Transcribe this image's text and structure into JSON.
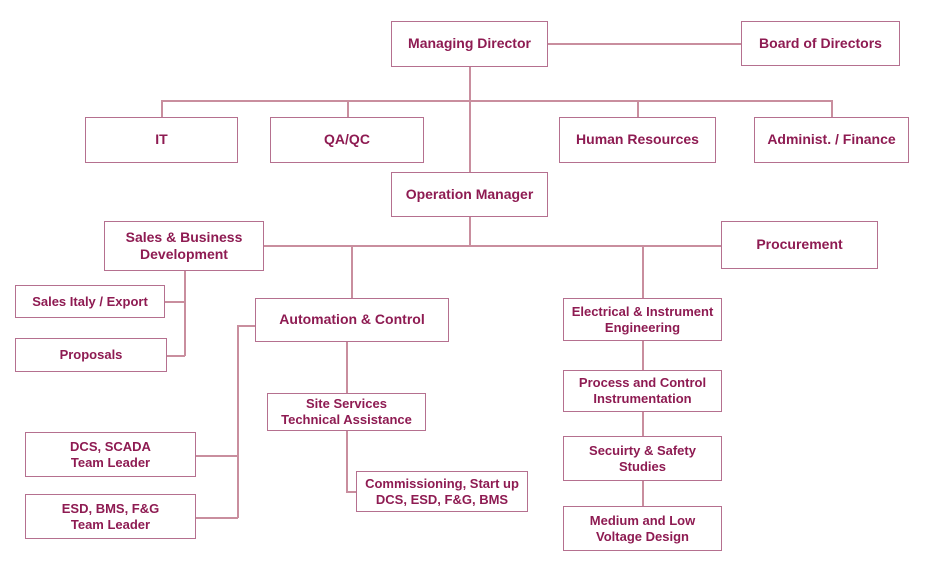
{
  "chart_data": {
    "type": "diagram",
    "title": "Company Organization Chart",
    "diagram_kind": "organizational-chart",
    "colors": {
      "box_border": "#b5708f",
      "text": "#8e1b52",
      "connector": "#c98e9e",
      "background": "#ffffff"
    },
    "nodes": [
      {
        "id": "managing_director",
        "label": "Managing Director",
        "level": 1
      },
      {
        "id": "board_of_directors",
        "label": "Board of Directors",
        "level": 1
      },
      {
        "id": "it",
        "label": "IT",
        "level": 2
      },
      {
        "id": "qa_qc",
        "label": "QA/QC",
        "level": 2
      },
      {
        "id": "human_resources",
        "label": "Human Resources",
        "level": 2
      },
      {
        "id": "admin_finance",
        "label": "Administ. / Finance",
        "level": 2
      },
      {
        "id": "operation_manager",
        "label": "Operation Manager",
        "level": 3
      },
      {
        "id": "sales_business_development",
        "label": "Sales & Business\nDevelopment",
        "level": 4
      },
      {
        "id": "procurement",
        "label": "Procurement",
        "level": 4
      },
      {
        "id": "sales_italy_export",
        "label": "Sales Italy / Export",
        "level": 5
      },
      {
        "id": "proposals",
        "label": "Proposals",
        "level": 5
      },
      {
        "id": "automation_control",
        "label": "Automation & Control",
        "level": 5
      },
      {
        "id": "electrical_instrument_engineering",
        "label": "Electrical & Instrument\nEngineering",
        "level": 5
      },
      {
        "id": "process_control_instrumentation",
        "label": "Process and Control\nInstrumentation",
        "level": 6
      },
      {
        "id": "site_services_technical_assistance",
        "label": "Site Services\nTechnical Assistance",
        "level": 6
      },
      {
        "id": "security_safety_studies",
        "label": "Secuirty & Safety\nStudies",
        "level": 7
      },
      {
        "id": "dcs_scada_team_leader",
        "label": "DCS, SCADA\nTeam Leader",
        "level": 7
      },
      {
        "id": "commissioning_startup",
        "label": "Commissioning, Start up\nDCS, ESD, F&G, BMS",
        "level": 7
      },
      {
        "id": "esd_bms_fg_team_leader",
        "label": "ESD, BMS, F&G\nTeam Leader",
        "level": 8
      },
      {
        "id": "medium_low_voltage_design",
        "label": "Medium and Low\nVoltage Design",
        "level": 8
      }
    ],
    "edges": [
      {
        "from": "managing_director",
        "to": "board_of_directors"
      },
      {
        "from": "managing_director",
        "to": "it"
      },
      {
        "from": "managing_director",
        "to": "qa_qc"
      },
      {
        "from": "managing_director",
        "to": "human_resources"
      },
      {
        "from": "managing_director",
        "to": "admin_finance"
      },
      {
        "from": "managing_director",
        "to": "operation_manager"
      },
      {
        "from": "operation_manager",
        "to": "sales_business_development"
      },
      {
        "from": "operation_manager",
        "to": "procurement"
      },
      {
        "from": "operation_manager",
        "to": "automation_control"
      },
      {
        "from": "operation_manager",
        "to": "electrical_instrument_engineering"
      },
      {
        "from": "sales_business_development",
        "to": "sales_italy_export"
      },
      {
        "from": "sales_business_development",
        "to": "proposals"
      },
      {
        "from": "automation_control",
        "to": "site_services_technical_assistance"
      },
      {
        "from": "automation_control",
        "to": "dcs_scada_team_leader"
      },
      {
        "from": "automation_control",
        "to": "esd_bms_fg_team_leader"
      },
      {
        "from": "site_services_technical_assistance",
        "to": "commissioning_startup"
      },
      {
        "from": "electrical_instrument_engineering",
        "to": "process_control_instrumentation"
      },
      {
        "from": "process_control_instrumentation",
        "to": "security_safety_studies"
      },
      {
        "from": "security_safety_studies",
        "to": "medium_low_voltage_design"
      }
    ]
  },
  "boxes": {
    "managing_director": {
      "line1": "Managing Director"
    },
    "board_of_directors": {
      "line1": "Board of Directors"
    },
    "it": {
      "line1": "IT"
    },
    "qa_qc": {
      "line1": "QA/QC"
    },
    "human_resources": {
      "line1": "Human Resources"
    },
    "admin_finance": {
      "line1": "Administ. / Finance"
    },
    "operation_manager": {
      "line1": "Operation Manager"
    },
    "sales_business_development": {
      "line1": "Sales & Business",
      "line2": "Development"
    },
    "procurement": {
      "line1": "Procurement"
    },
    "sales_italy_export": {
      "line1": "Sales Italy / Export"
    },
    "proposals": {
      "line1": "Proposals"
    },
    "automation_control": {
      "line1": "Automation & Control"
    },
    "electrical_instrument_engineering": {
      "line1": "Electrical & Instrument",
      "line2": "Engineering"
    },
    "process_control_instrumentation": {
      "line1": "Process and Control",
      "line2": "Instrumentation"
    },
    "site_services_technical_assistance": {
      "line1": "Site Services",
      "line2": "Technical Assistance"
    },
    "security_safety_studies": {
      "line1": "Secuirty & Safety",
      "line2": "Studies"
    },
    "dcs_scada_team_leader": {
      "line1": "DCS, SCADA",
      "line2": "Team Leader"
    },
    "commissioning_startup": {
      "line1": "Commissioning, Start up",
      "line2": "DCS, ESD, F&G, BMS"
    },
    "esd_bms_fg_team_leader": {
      "line1": "ESD, BMS, F&G",
      "line2": "Team Leader"
    },
    "medium_low_voltage_design": {
      "line1": "Medium and Low",
      "line2": "Voltage Design"
    }
  }
}
